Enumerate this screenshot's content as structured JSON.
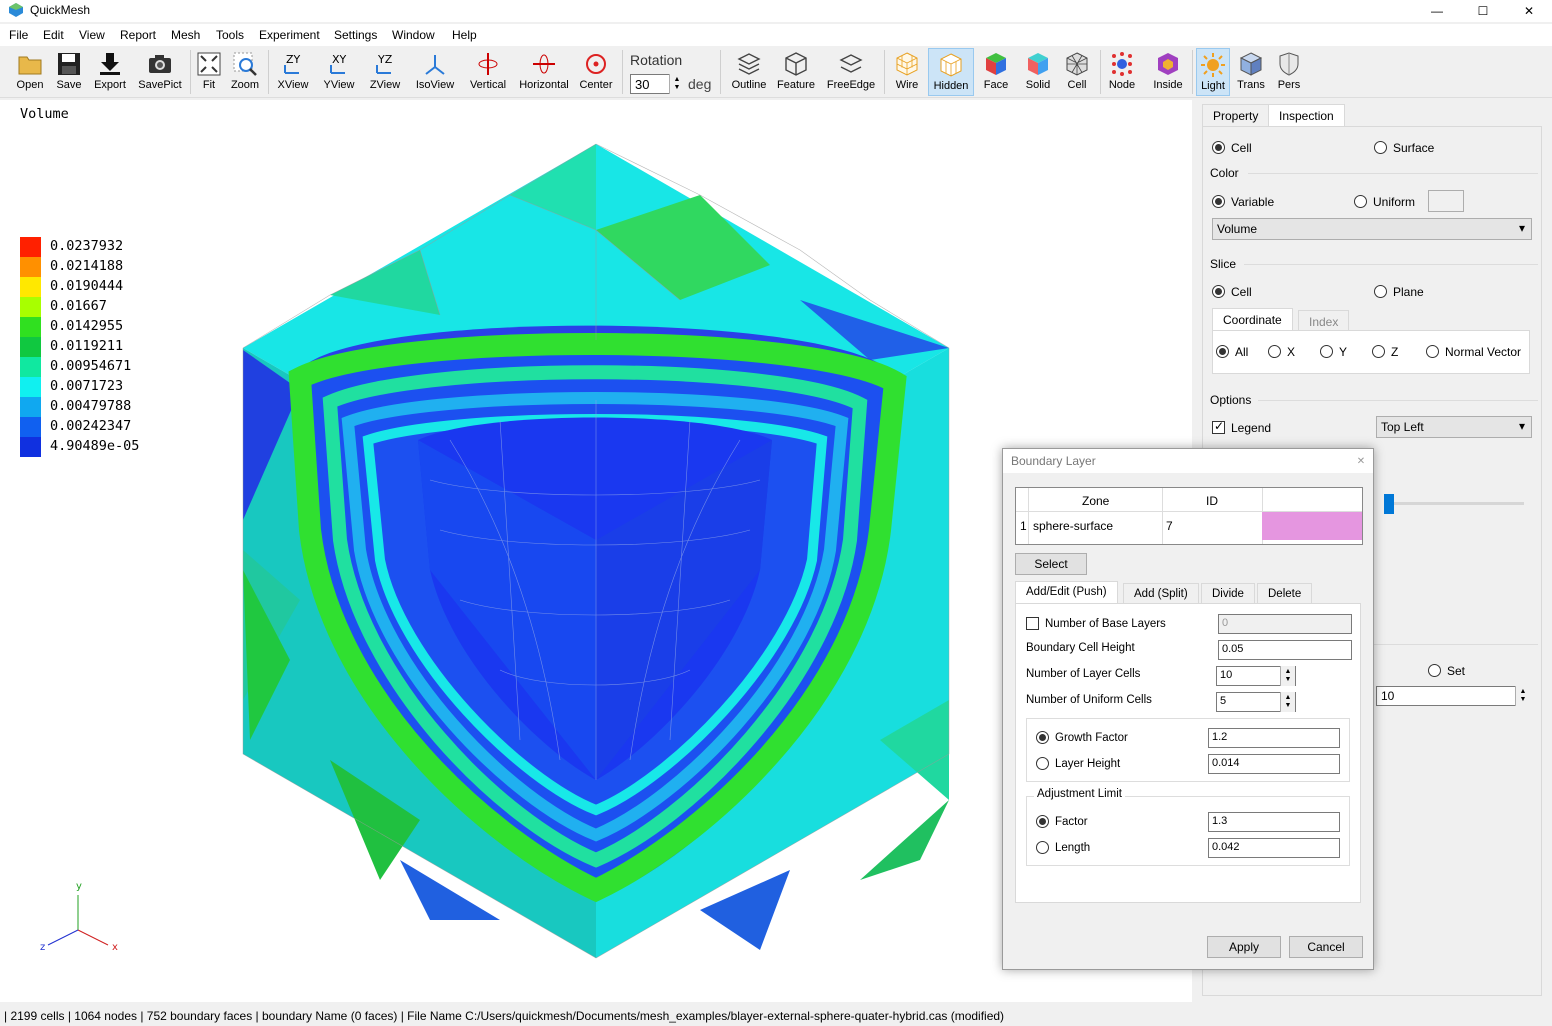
{
  "app": {
    "title": "QuickMesh"
  },
  "window_controls": {
    "minimize": "—",
    "maximize": "☐",
    "close": "✕"
  },
  "menu": [
    "File",
    "Edit",
    "View",
    "Report",
    "Mesh",
    "Tools",
    "Experiment",
    "Settings",
    "Window",
    "Help"
  ],
  "toolbar": {
    "open": "Open",
    "save": "Save",
    "export": "Export",
    "savepict": "SavePict",
    "fit": "Fit",
    "zoom": "Zoom",
    "xview": "XView",
    "yview": "YView",
    "zview": "ZView",
    "isoview": "IsoView",
    "vertical": "Vertical",
    "horizontal": "Horizontal",
    "center": "Center",
    "rotation_label": "Rotation",
    "rotation_value": "30",
    "rotation_unit": "deg",
    "outline": "Outline",
    "feature": "Feature",
    "freeedge": "FreeEdge",
    "wire": "Wire",
    "hidden": "Hidden",
    "face": "Face",
    "solid": "Solid",
    "cell": "Cell",
    "node": "Node",
    "inside": "Inside",
    "light": "Light",
    "trans": "Trans",
    "pers": "Pers"
  },
  "legend": {
    "title": "Volume",
    "values": [
      "0.0237932",
      "0.0214188",
      "0.0190444",
      "0.01667",
      "0.0142955",
      "0.0119211",
      "0.00954671",
      "0.0071723",
      "0.00479788",
      "0.00242347",
      "4.90489e-05"
    ],
    "colors": [
      "#ff2000",
      "#ff9000",
      "#ffe800",
      "#a8ff00",
      "#30e020",
      "#10c840",
      "#10e8a0",
      "#10f0f0",
      "#10a8f0",
      "#1060f0",
      "#1030e0"
    ]
  },
  "axes": {
    "x": "x",
    "y": "y",
    "z": "z"
  },
  "status": "| 2199 cells | 1064 nodes | 752 boundary faces |  boundary Name  (0 faces) | File Name C:/Users/quickmesh/Documents/mesh_examples/blayer-external-sphere-quater-hybrid.cas (modified)",
  "panel": {
    "tabs": [
      "Property",
      "Inspection"
    ],
    "cell": "Cell",
    "surface": "Surface",
    "color_label": "Color",
    "variable": "Variable",
    "uniform": "Uniform",
    "variable_value": "Volume",
    "slice_label": "Slice",
    "slice_cell": "Cell",
    "slice_plane": "Plane",
    "subtabs": [
      "Coordinate",
      "Index"
    ],
    "coord": [
      "All",
      "X",
      "Y",
      "Z",
      "Normal Vector"
    ],
    "options_label": "Options",
    "legend_cb": "Legend",
    "legend_pos": "Top Left",
    "set": "Set",
    "set_value": "10"
  },
  "dialog": {
    "title": "Boundary Layer",
    "table_headers": [
      "Zone",
      "ID"
    ],
    "row": {
      "index": "1",
      "zone": "sphere-surface",
      "id": "7",
      "color": "#e596e0"
    },
    "select": "Select",
    "tabs": [
      "Add/Edit (Push)",
      "Add (Split)",
      "Divide",
      "Delete"
    ],
    "base_layers_label": "Number of Base Layers",
    "base_layers_value": "0",
    "cell_height_label": "Boundary Cell Height",
    "cell_height_value": "0.05",
    "layer_cells_label": "Number of Layer Cells",
    "layer_cells_value": "10",
    "uniform_cells_label": "Number of Uniform Cells",
    "uniform_cells_value": "5",
    "growth_label": "Growth Factor",
    "growth_value": "1.2",
    "layer_height_label": "Layer Height",
    "layer_height_value": "0.014",
    "adjust_label": "Adjustment Limit",
    "factor_label": "Factor",
    "factor_value": "1.3",
    "length_label": "Length",
    "length_value": "0.042",
    "apply": "Apply",
    "cancel": "Cancel"
  }
}
